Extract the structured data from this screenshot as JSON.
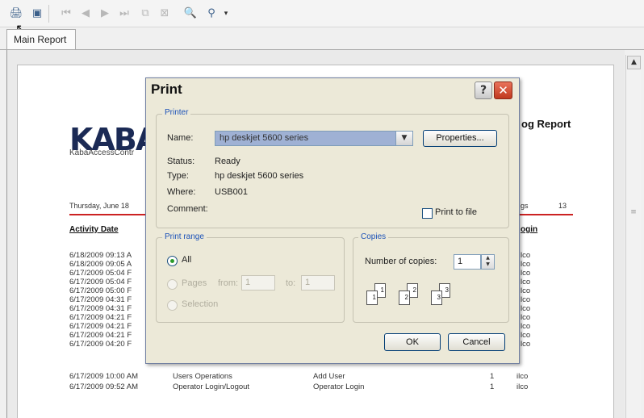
{
  "toolbar": {
    "buttons": [
      {
        "name": "print-icon",
        "glyph": "🖨"
      },
      {
        "name": "export-icon",
        "glyph": "▣"
      },
      {
        "name": "first-page-icon",
        "glyph": "⏮"
      },
      {
        "name": "prev-page-icon",
        "glyph": "◀"
      },
      {
        "name": "next-page-icon",
        "glyph": "▶"
      },
      {
        "name": "last-page-icon",
        "glyph": "⏭"
      },
      {
        "name": "goto-page-icon",
        "glyph": "⧉"
      },
      {
        "name": "stop-icon",
        "glyph": "⊠"
      },
      {
        "name": "find-icon",
        "glyph": "🔍"
      },
      {
        "name": "zoom-icon",
        "glyph": "⚲"
      }
    ]
  },
  "tab": {
    "label": "Main Report"
  },
  "report": {
    "logo": "KABA",
    "logo_sub": "KabaAccessContr",
    "title": "og Report",
    "date": "Thursday, June 18",
    "pages_label": "gs",
    "pages_value": "13",
    "col_activity": "Activity Date",
    "col_login": "ogin",
    "rows": [
      {
        "date": "6/18/2009  09:13 A",
        "a": "",
        "b": "",
        "n": "",
        "u": "lco"
      },
      {
        "date": "6/18/2009  09:05 A",
        "a": "",
        "b": "",
        "n": "",
        "u": "lco"
      },
      {
        "date": "6/17/2009  05:04 F",
        "a": "",
        "b": "",
        "n": "",
        "u": "lco"
      },
      {
        "date": "6/17/2009  05:04 F",
        "a": "",
        "b": "",
        "n": "",
        "u": "lco"
      },
      {
        "date": "6/17/2009  05:00 F",
        "a": "",
        "b": "",
        "n": "",
        "u": "lco"
      },
      {
        "date": "6/17/2009  04:31 F",
        "a": "",
        "b": "",
        "n": "",
        "u": "lco"
      },
      {
        "date": "6/17/2009  04:31 F",
        "a": "",
        "b": "",
        "n": "",
        "u": "lco"
      },
      {
        "date": "6/17/2009  04:21 F",
        "a": "",
        "b": "",
        "n": "",
        "u": "lco"
      },
      {
        "date": "6/17/2009  04:21 F",
        "a": "",
        "b": "",
        "n": "",
        "u": "lco"
      },
      {
        "date": "6/17/2009  04:21 F",
        "a": "",
        "b": "",
        "n": "",
        "u": "lco"
      },
      {
        "date": "6/17/2009  04:20 F",
        "a": "",
        "b": "",
        "n": "",
        "u": "lco"
      },
      {
        "date": "6/17/2009  10:00 AM",
        "a": "Users Operations",
        "b": "Add User",
        "n": "1",
        "u": "ilco"
      },
      {
        "date": "6/17/2009  09:52 AM",
        "a": "Operator Login/Logout",
        "b": "Operator Login",
        "n": "1",
        "u": "ilco"
      }
    ]
  },
  "dialog": {
    "title": "Print",
    "printer_group": "Printer",
    "name_label": "Name:",
    "name_value": "hp deskjet 5600 series",
    "properties_button": "Properties...",
    "status_label": "Status:",
    "status_value": "Ready",
    "type_label": "Type:",
    "type_value": "hp deskjet 5600 series",
    "where_label": "Where:",
    "where_value": "USB001",
    "comment_label": "Comment:",
    "print_to_file": "Print to file",
    "range_group": "Print range",
    "all_label": "All",
    "pages_label": "Pages",
    "from_label": "from:",
    "from_value": "1",
    "to_label": "to:",
    "to_value": "1",
    "selection_label": "Selection",
    "copies_group": "Copies",
    "copies_label": "Number of copies:",
    "copies_value": "1",
    "collate_digits": [
      "1",
      "1",
      "2",
      "2",
      "3",
      "3"
    ],
    "ok_button": "OK",
    "cancel_button": "Cancel"
  }
}
